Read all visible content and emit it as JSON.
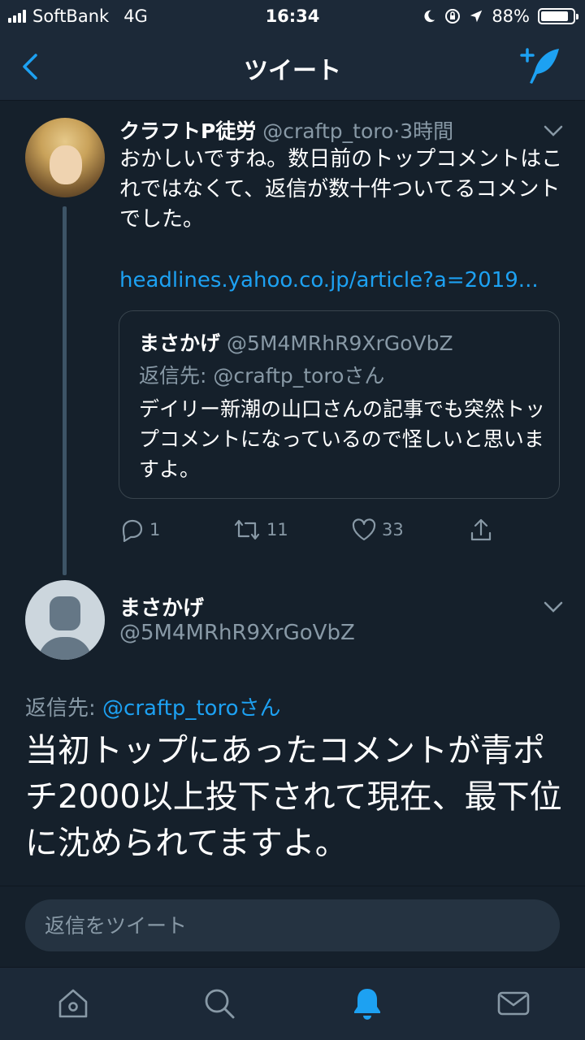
{
  "status_bar": {
    "carrier": "SoftBank",
    "network": "4G",
    "time": "16:34",
    "battery": "88%",
    "battery_level": 0.88
  },
  "nav": {
    "title": "ツイート"
  },
  "tweet1": {
    "author_name": "クラフトP徒労",
    "author_handle": "@craftp_toro",
    "separator": "·",
    "time": "3時間",
    "text": "おかしいですね。数日前のトップコメントはこれではなくて、返信が数十件ついてるコメントでした。",
    "link": "headlines.yahoo.co.jp/article?a=2019...",
    "quote": {
      "author_name": "まさかげ",
      "author_handle": "@5M4MRhR9XrGoVbZ",
      "reply_to": "返信先: @craftp_toroさん",
      "text": "デイリー新潮の山口さんの記事でも突然トップコメントになっているので怪しいと思いますよ。"
    },
    "actions": {
      "replies": "1",
      "retweets": "11",
      "likes": "33"
    }
  },
  "tweet2": {
    "author_name": "まさかげ",
    "author_handle": "@5M4MRhR9XrGoVbZ",
    "reply_label": "返信先: ",
    "reply_mention": "@craftp_toroさん",
    "text": "当初トップにあったコメントが青ポチ2000以上投下されて現在、最下位に沈められてますよ。"
  },
  "reply_box": {
    "placeholder": "返信をツイート"
  },
  "tab_bar": {
    "items": [
      "home-icon",
      "search-icon",
      "notifications-icon",
      "messages-icon"
    ],
    "active": "notifications-icon"
  },
  "colors": {
    "background": "#15202b",
    "bar": "#1c2938",
    "accent": "#1da1f2",
    "secondary_text": "#8899a6"
  }
}
